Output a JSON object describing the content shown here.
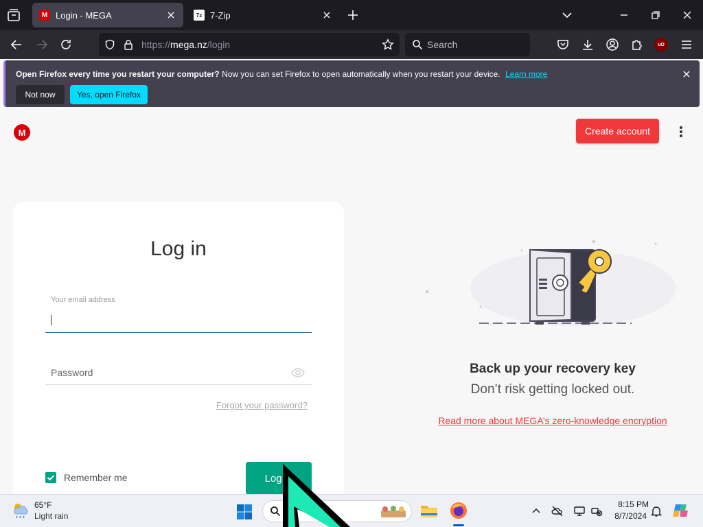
{
  "browser": {
    "tabs": [
      {
        "title": "Login - MEGA",
        "active": true
      },
      {
        "title": "7-Zip",
        "active": false
      }
    ],
    "url": {
      "scheme": "https://",
      "host": "mega.nz",
      "path": "/login"
    },
    "search_placeholder": "Search",
    "notification": {
      "bold": "Open Firefox every time you restart your computer?",
      "text": "Now you can set Firefox to open automatically when you restart your device.",
      "link": "Learn more",
      "btn_not_now": "Not now",
      "btn_yes": "Yes, open Firefox"
    }
  },
  "page": {
    "logo": "M",
    "create_account": "Create account",
    "login_form": {
      "title": "Log in",
      "email_placeholder": "Your email address",
      "password_placeholder": "Password",
      "forgot": "Forgot your password?",
      "remember": "Remember me",
      "login_button": "Log in"
    },
    "promo": {
      "title": "Back up your recovery key",
      "subtitle": "Don’t risk getting locked out.",
      "link": "Read more about MEGA’s zero-knowledge encryption"
    }
  },
  "taskbar": {
    "weather_temp": "65°F",
    "weather_desc": "Light rain",
    "time": "8:15 PM",
    "date": "8/7/2024"
  },
  "colors": {
    "mega_red": "#d90007",
    "create_btn": "#f0373a",
    "login_green": "#00a382",
    "firefox_dark": "#1c1b22",
    "notif_accent": "#00ddff"
  }
}
